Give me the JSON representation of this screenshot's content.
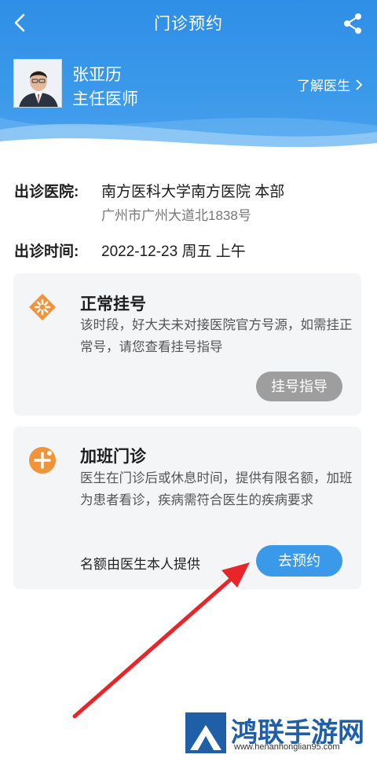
{
  "nav": {
    "title": "门诊预约",
    "back_icon": "back-arrow-icon",
    "share_icon": "share-icon"
  },
  "doctor": {
    "name": "张亚历",
    "title": "主任医师",
    "about_label": "了解医生"
  },
  "clinic": {
    "hospital_label": "出诊医院:",
    "hospital_name": "南方医科大学南方医院 本部",
    "hospital_address": "广州市广州大道北1838号",
    "time_label": "出诊时间:",
    "time_value": "2022-12-23 周五 上午"
  },
  "normal": {
    "title": "正常挂号",
    "desc": "该时段，好大夫未对接医院官方号源，如需挂正常号，请您查看挂号指导",
    "button": "挂号指导",
    "icon": "diamond-star-icon"
  },
  "extra": {
    "title": "加班门诊",
    "desc": "医生在门诊后或休息时间，提供有限名额，加班为患者看诊，疾病需符合医生的疾病要求",
    "quota": "名额由医生本人提供",
    "button": "去预约",
    "icon": "plus-circle-icon"
  },
  "watermark": {
    "text": "鸿联手游网",
    "url": "www.henanhonglian95.com"
  },
  "colors": {
    "primary": "#3a9ae9",
    "orange": "#f0943a",
    "annotation": "#e8262a"
  }
}
